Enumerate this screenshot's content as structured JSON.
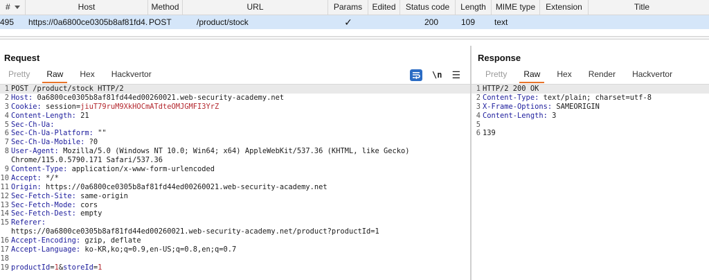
{
  "history": {
    "columns": [
      {
        "label": "#",
        "sorted": true
      },
      {
        "label": "Host"
      },
      {
        "label": "Method"
      },
      {
        "label": "URL"
      },
      {
        "label": "Params"
      },
      {
        "label": "Edited"
      },
      {
        "label": "Status code"
      },
      {
        "label": "Length"
      },
      {
        "label": "MIME type"
      },
      {
        "label": "Extension"
      },
      {
        "label": "Title"
      }
    ],
    "row": {
      "num": "495",
      "host": "https://0a6800ce0305b8af81fd4...",
      "method": "POST",
      "url": "/product/stock",
      "params": "✓",
      "edited": "",
      "status": "200",
      "length": "109",
      "mime": "text",
      "extension": "",
      "title": ""
    }
  },
  "request": {
    "title": "Request",
    "tabs": [
      "Pretty",
      "Raw",
      "Hex",
      "Hackvertor"
    ],
    "active_tab": "Raw",
    "tools": {
      "wrap_icon": "wrap-lines-icon",
      "newline_label": "\\n",
      "menu_icon": "hamburger-menu-icon"
    },
    "lines": [
      {
        "n": "1",
        "k": "",
        "v": "POST /product/stock HTTP/2"
      },
      {
        "n": "2",
        "k": "Host:",
        "v": " 0a6800ce0305b8af81fd44ed00260021.web-security-academy.net"
      },
      {
        "n": "3",
        "k": "Cookie:",
        "v": " session=jiuT79ruM9XkHOCmATdteOMJGMFI3YrZ"
      },
      {
        "n": "4",
        "k": "Content-Length:",
        "v": " 21"
      },
      {
        "n": "5",
        "k": "Sec-Ch-Ua:",
        "v": ""
      },
      {
        "n": "6",
        "k": "Sec-Ch-Ua-Platform:",
        "v": " \"\""
      },
      {
        "n": "7",
        "k": "Sec-Ch-Ua-Mobile:",
        "v": " ?0"
      },
      {
        "n": "8",
        "k": "User-Agent:",
        "v": " Mozilla/5.0 (Windows NT 10.0; Win64; x64) AppleWebKit/537.36 (KHTML, like Gecko)",
        "cont": "Chrome/115.0.5790.171 Safari/537.36"
      },
      {
        "n": "9",
        "k": "Content-Type:",
        "v": " application/x-www-form-urlencoded"
      },
      {
        "n": "10",
        "k": "Accept:",
        "v": " */*"
      },
      {
        "n": "11",
        "k": "Origin:",
        "v": " https://0a6800ce0305b8af81fd44ed00260021.web-security-academy.net"
      },
      {
        "n": "12",
        "k": "Sec-Fetch-Site:",
        "v": " same-origin"
      },
      {
        "n": "13",
        "k": "Sec-Fetch-Mode:",
        "v": " cors"
      },
      {
        "n": "14",
        "k": "Sec-Fetch-Dest:",
        "v": " empty"
      },
      {
        "n": "15",
        "k": "Referer:",
        "v": "",
        "cont": "https://0a6800ce0305b8af81fd44ed00260021.web-security-academy.net/product?productId=1"
      },
      {
        "n": "16",
        "k": "Accept-Encoding:",
        "v": " gzip, deflate"
      },
      {
        "n": "17",
        "k": "Accept-Language:",
        "v": " ko-KR,ko;q=0.9,en-US;q=0.8,en;q=0.7"
      },
      {
        "n": "18",
        "k": "",
        "v": ""
      },
      {
        "n": "19",
        "body": true,
        "p1n": "productId",
        "p1v": "1",
        "amp": "&",
        "p2n": "storeId",
        "p2v": "1"
      }
    ]
  },
  "response": {
    "title": "Response",
    "tabs": [
      "Pretty",
      "Raw",
      "Hex",
      "Render",
      "Hackvertor"
    ],
    "active_tab": "Raw",
    "lines": [
      {
        "n": "1",
        "k": "",
        "v": "HTTP/2 200 OK"
      },
      {
        "n": "2",
        "k": "Content-Type:",
        "v": " text/plain; charset=utf-8"
      },
      {
        "n": "3",
        "k": "X-Frame-Options:",
        "v": " SAMEORIGIN"
      },
      {
        "n": "4",
        "k": "Content-Length:",
        "v": " 3"
      },
      {
        "n": "5",
        "k": "",
        "v": ""
      },
      {
        "n": "6",
        "k": "",
        "v": "139"
      }
    ]
  },
  "colors": {
    "accent": "#e8742a",
    "selection": "#d5e6f9",
    "header_key": "#1c1c9c",
    "value_red": "#b3262d"
  }
}
